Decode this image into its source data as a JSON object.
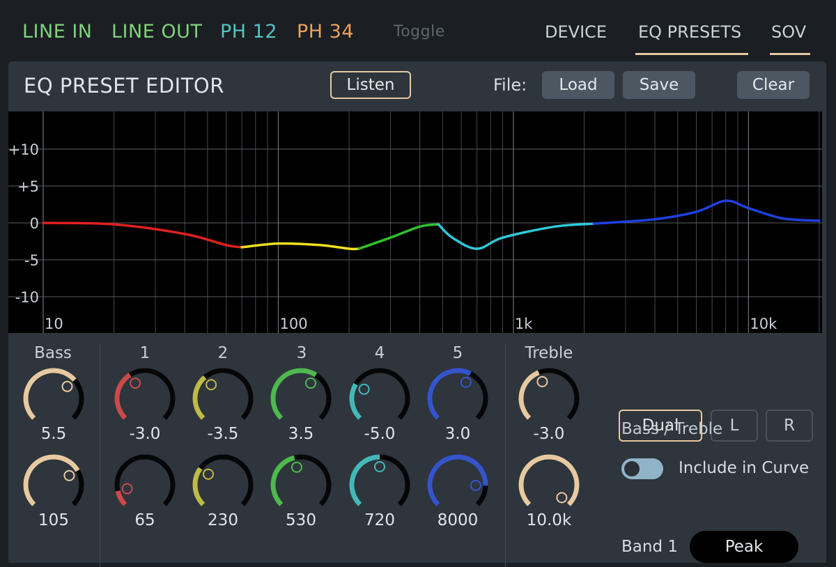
{
  "topbar": {
    "tabs": [
      {
        "label": "LINE IN",
        "color": "#7fd37c"
      },
      {
        "label": "LINE OUT",
        "color": "#7fd37c"
      },
      {
        "label": "PH 12",
        "color": "#56c3c4"
      },
      {
        "label": "PH 34",
        "color": "#e9a35e"
      }
    ],
    "toggle_label": "Toggle",
    "nav": [
      "DEVICE",
      "EQ PRESETS",
      "SOV"
    ],
    "active_nav": "EQ PRESETS"
  },
  "editor": {
    "title": "EQ PRESET EDITOR",
    "listen_label": "Listen",
    "file_label": "File:",
    "load_label": "Load",
    "save_label": "Save",
    "clear_label": "Clear"
  },
  "graph": {
    "y_ticks": [
      "+10",
      "+5",
      "0",
      "-5",
      "-10"
    ],
    "x_ticks": [
      "10",
      "100",
      "1k",
      "10k"
    ]
  },
  "chart_data": {
    "type": "line",
    "x_scale": "log",
    "xlim": [
      10,
      20000
    ],
    "ylim": [
      -14,
      15
    ],
    "series": [
      {
        "color": "#e02020",
        "x": [
          10,
          20,
          40,
          60,
          70
        ],
        "y": [
          0,
          -0.2,
          -1.5,
          -3.0,
          -3.3
        ]
      },
      {
        "color": "#f0e020",
        "x": [
          70,
          100,
          150,
          200,
          220
        ],
        "y": [
          -3.3,
          -2.8,
          -3.0,
          -3.5,
          -3.5
        ]
      },
      {
        "color": "#30c030",
        "x": [
          220,
          300,
          400,
          480
        ],
        "y": [
          -3.5,
          -2.0,
          -0.5,
          -0.2
        ]
      },
      {
        "color": "#30c8d8",
        "x": [
          480,
          550,
          700,
          900,
          1500,
          2200
        ],
        "y": [
          -0.2,
          -2.0,
          -3.5,
          -2.0,
          -0.5,
          -0.1
        ]
      },
      {
        "color": "#2040e0",
        "x": [
          2200,
          4000,
          6000,
          8000,
          10000,
          14000,
          20000
        ],
        "y": [
          -0.1,
          0.5,
          1.5,
          3.0,
          2.0,
          0.6,
          0.3
        ]
      }
    ]
  },
  "knobs": {
    "bass_label": "Bass",
    "treble_label": "Treble",
    "band_numbers": [
      "1",
      "2",
      "3",
      "4",
      "5"
    ],
    "bass": [
      {
        "value": "5.5",
        "level": 0.68,
        "color": "#e7c9a1"
      },
      {
        "value": "105",
        "level": 0.72,
        "color": "#e7c9a1"
      }
    ],
    "treble": [
      {
        "value": "-3.0",
        "level": 0.42,
        "color": "#e7c9a1"
      },
      {
        "value": "10.0k",
        "level": 1.0,
        "color": "#e7c9a1"
      }
    ],
    "bands": [
      {
        "color": "#c94b4b",
        "gain": "-3.0",
        "gain_level": 0.38,
        "freq": "65",
        "freq_level": 0.12
      },
      {
        "color": "#c0bb45",
        "gain": "-3.5",
        "gain_level": 0.35,
        "freq": "230",
        "freq_level": 0.3
      },
      {
        "color": "#4fb84f",
        "gain": "3.5",
        "gain_level": 0.62,
        "freq": "530",
        "freq_level": 0.45
      },
      {
        "color": "#44b8b8",
        "gain": "-5.0",
        "gain_level": 0.28,
        "freq": "720",
        "freq_level": 0.5
      },
      {
        "color": "#3554cc",
        "gain": "3.0",
        "gain_level": 0.6,
        "freq": "8000",
        "freq_level": 0.84
      }
    ]
  },
  "channel": {
    "dual_label": "Dual",
    "l_label": "L",
    "r_label": "R"
  },
  "bass_treble": {
    "label": "Bass / Treble",
    "include_label": "Include in Curve",
    "include_on": true
  },
  "band": {
    "label": "Band 1",
    "type": "Peak"
  }
}
